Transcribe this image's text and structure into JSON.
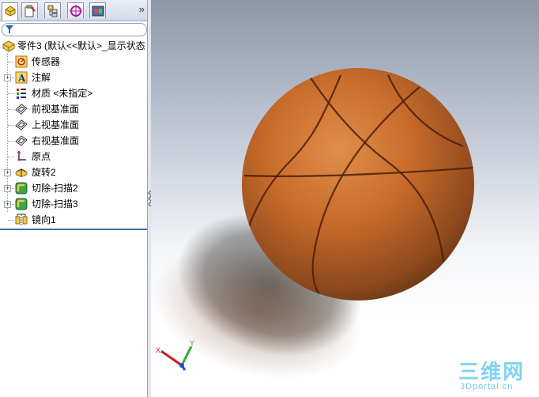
{
  "panel": {
    "tabs": [
      {
        "name": "feature-manager-tab-icon",
        "active": true
      },
      {
        "name": "property-manager-tab-icon",
        "active": false
      },
      {
        "name": "configuration-manager-tab-icon",
        "active": false
      },
      {
        "name": "dimxpert-manager-tab-icon",
        "active": false
      },
      {
        "name": "display-manager-tab-icon",
        "active": false
      }
    ],
    "more": "»"
  },
  "tree": {
    "root": "零件3  (默认<<默认>_显示状态",
    "items": [
      {
        "label": "传感器",
        "icon": "sensor-icon",
        "expandable": false
      },
      {
        "label": "注解",
        "icon": "annotation-icon",
        "expandable": true
      },
      {
        "label": "材质 <未指定>",
        "icon": "material-icon",
        "expandable": false
      },
      {
        "label": "前视基准面",
        "icon": "plane-icon",
        "expandable": false
      },
      {
        "label": "上视基准面",
        "icon": "plane-icon",
        "expandable": false
      },
      {
        "label": "右视基准面",
        "icon": "plane-icon",
        "expandable": false
      },
      {
        "label": "原点",
        "icon": "origin-icon",
        "expandable": false
      },
      {
        "label": "旋转2",
        "icon": "revolve-icon",
        "expandable": true
      },
      {
        "label": "切除-扫描2",
        "icon": "sweep-cut-icon",
        "expandable": true
      },
      {
        "label": "切除-扫描3",
        "icon": "sweep-cut-icon",
        "expandable": true
      },
      {
        "label": "镜向1",
        "icon": "mirror-icon",
        "expandable": false
      }
    ]
  },
  "triad": {
    "x": "X",
    "y": "Y"
  },
  "watermark": {
    "main": "三维网",
    "sub": "3Dportal.cn"
  },
  "colors": {
    "ball": "#c8651f",
    "tabbar": "#dfe5ef",
    "rollback": "#3b6fb5"
  }
}
